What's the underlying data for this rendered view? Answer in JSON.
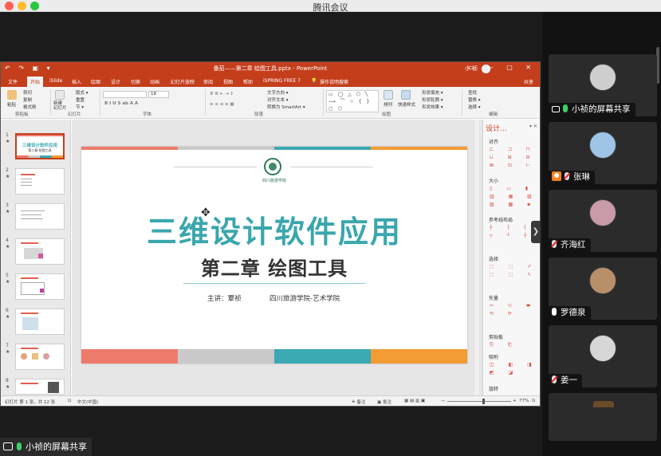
{
  "app": {
    "title": "腾讯会议"
  },
  "ppt": {
    "title": "番茄——第二章 绘图工具.pptx - PowerPoint",
    "quick_access": "↶ ↷ ▣ ▾",
    "user": "小 祯",
    "window_controls": "▭ — ▢ ✕",
    "tabs": [
      "文件",
      "开始",
      "iSlide",
      "插入",
      "绘图",
      "设计",
      "切换",
      "动画",
      "幻灯片放映",
      "审阅",
      "视图",
      "帮助",
      "iSPRING FREE 7",
      "💡",
      "操作说明搜索"
    ],
    "active_tab": "开始",
    "share": "共享",
    "ribbon": {
      "groups": [
        "剪贴板",
        "幻灯片",
        "字体",
        "段落",
        "绘图",
        "编辑"
      ],
      "paste": "粘贴",
      "cut": "剪切",
      "copy": "复制",
      "format_painter": "格式刷",
      "new_slide": "新建\n幻灯片",
      "layout": "版式 ▾",
      "reset": "重置",
      "section": "节 ▾",
      "font_size": "18",
      "text_direction": "文字方向 ▾",
      "align_text": "对齐文本 ▾",
      "smartart": "转换为 SmartArt ▾",
      "arrange": "排列",
      "quick_styles": "快速样式",
      "shape_fill": "形状填充 ▾",
      "shape_outline": "形状轮廓 ▾",
      "shape_effects": "形状效果 ▾",
      "find": "查找",
      "replace": "替换 ▾",
      "select": "选择 ▾",
      "shapes": "▭ ◯ △ ⬠ ╲ ⟶ ⌒ ☆ { } ▢ ⬡"
    },
    "slides": [
      {
        "num": "1",
        "star": "★"
      },
      {
        "num": "2",
        "star": "★"
      },
      {
        "num": "3",
        "star": "★"
      },
      {
        "num": "4",
        "star": "★"
      },
      {
        "num": "5",
        "star": "★"
      },
      {
        "num": "6",
        "star": "★"
      },
      {
        "num": "7",
        "star": "★"
      },
      {
        "num": "8",
        "star": "★"
      }
    ],
    "thumb1": {
      "title": "三维设计软件应用",
      "subtitle": "第二章 绘图工具"
    },
    "slide": {
      "logo_text": "四川旅游学院",
      "title": "三维设计软件应用",
      "subtitle": "第二章  绘图工具",
      "lecturer": "主讲：覃祯",
      "school": "四川旅游学院-艺术学院",
      "colors": {
        "salmon": "#ee7a6b",
        "gray": "#c9c9c9",
        "teal": "#3aa9b4",
        "orange": "#f39b35"
      }
    },
    "design_pane": {
      "title": "设计...",
      "close": "▾ ✕",
      "sections": [
        "对齐",
        "大小",
        "参考线布局",
        "选择",
        "矢量",
        "剪贴板",
        "吸附",
        "旋转"
      ],
      "icons": {
        "align": "⊏ ⊐ ⊓\n⊔ ⊞ ⊟\n⊠ ⊡ ⊢",
        "size": "▯ ▭ ▮\n▥ ▦ ▧\n▨ ▩ ▪",
        "guides": "┼ ├ ┤\n┬ ┴ ┼",
        "select": "⬚ ⬚ ↗\n⬚ ⬚ ↖",
        "vector": "✂ ⬭ ⬬\n⟲ ⟳",
        "clipboard": "⎘ ⎗",
        "snap": "◫ ◧ ◨\n◩ ◪"
      }
    },
    "status": {
      "slide_info": "幻灯片 第 1 张，共 12 张",
      "accessibility": "⊡",
      "language": "中文(中国)",
      "notes": "≜ 备注",
      "comments": "▣ 批注",
      "views": "▦  ▤  ▥  ▣",
      "zoom_minus": "—",
      "zoom_plus": "+",
      "zoom": "77%",
      "fit": "⊡"
    }
  },
  "share_label": "小祯的屏幕共享",
  "collapse_icon": "❯",
  "participants": [
    {
      "name": "小祯的屏幕共享",
      "type": "screen",
      "avatar_color": "#cfcfcf"
    },
    {
      "name": "张琳",
      "type": "person",
      "avatar_color": "#9ec4e8"
    },
    {
      "name": "齐海红",
      "type": "muted",
      "avatar_color": "#c99aa8"
    },
    {
      "name": "罗德泉",
      "type": "mic",
      "avatar_color": "#b98f6a"
    },
    {
      "name": "姜一",
      "type": "muted",
      "avatar_color": "#d7d7d7"
    }
  ]
}
